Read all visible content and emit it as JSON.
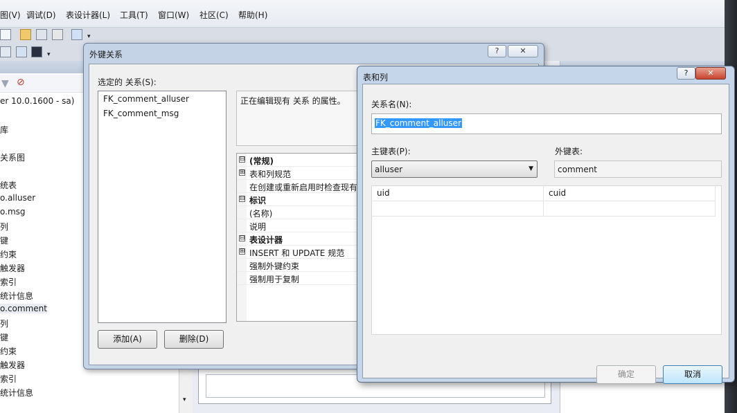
{
  "menubar": {
    "items": [
      "图(V)",
      "调试(D)",
      "表设计器(L)",
      "工具(T)",
      "窗口(W)",
      "社区(C)",
      "帮助(H)"
    ]
  },
  "explorer": {
    "server_node": "er 10.0.1600 - sa)",
    "items": [
      "库",
      "关系图",
      "统表",
      "o.alluser",
      "o.msg",
      "列",
      "键",
      "约束",
      "触发器",
      "索引",
      "统计信息",
      "o.comment",
      "列",
      "键",
      "约束",
      "触发器",
      "索引",
      "统计信息"
    ]
  },
  "fk_dialog": {
    "title": "外键关系",
    "help_label": "?",
    "close_label": "✕",
    "list_label": "选定的 关系(S):",
    "relationships": [
      "FK_comment_alluser",
      "FK_comment_msg"
    ],
    "description": "正在编辑现有 关系 的属性。",
    "properties": [
      {
        "text": "(常规)",
        "kind": "category",
        "expander": "⊟"
      },
      {
        "text": "表和列规范",
        "kind": "item",
        "expander": "⊞"
      },
      {
        "text": "在创建或重新启用时检查现有",
        "kind": "item",
        "expander": ""
      },
      {
        "text": "标识",
        "kind": "category",
        "expander": "⊟"
      },
      {
        "text": "(名称)",
        "kind": "item",
        "expander": ""
      },
      {
        "text": "说明",
        "kind": "item",
        "expander": ""
      },
      {
        "text": "表设计器",
        "kind": "category",
        "expander": "⊟"
      },
      {
        "text": "INSERT 和 UPDATE 规范",
        "kind": "item",
        "expander": "⊞"
      },
      {
        "text": "强制外键约束",
        "kind": "item",
        "expander": ""
      },
      {
        "text": "强制用于复制",
        "kind": "item",
        "expander": ""
      }
    ],
    "add_button": "添加(A)",
    "delete_button": "删除(D)"
  },
  "tc_dialog": {
    "title": "表和列",
    "help_label": "?",
    "close_label": "✕",
    "name_label": "关系名(N):",
    "name_value": "FK_comment_alluser",
    "pk_label": "主键表(P):",
    "pk_value": "alluser",
    "fk_label": "外键表:",
    "fk_value": "comment",
    "columns": [
      {
        "pk": "uid",
        "fk": "cuid"
      },
      {
        "pk": "",
        "fk": ""
      }
    ],
    "ok_button": "确定",
    "cancel_button": "取消"
  }
}
